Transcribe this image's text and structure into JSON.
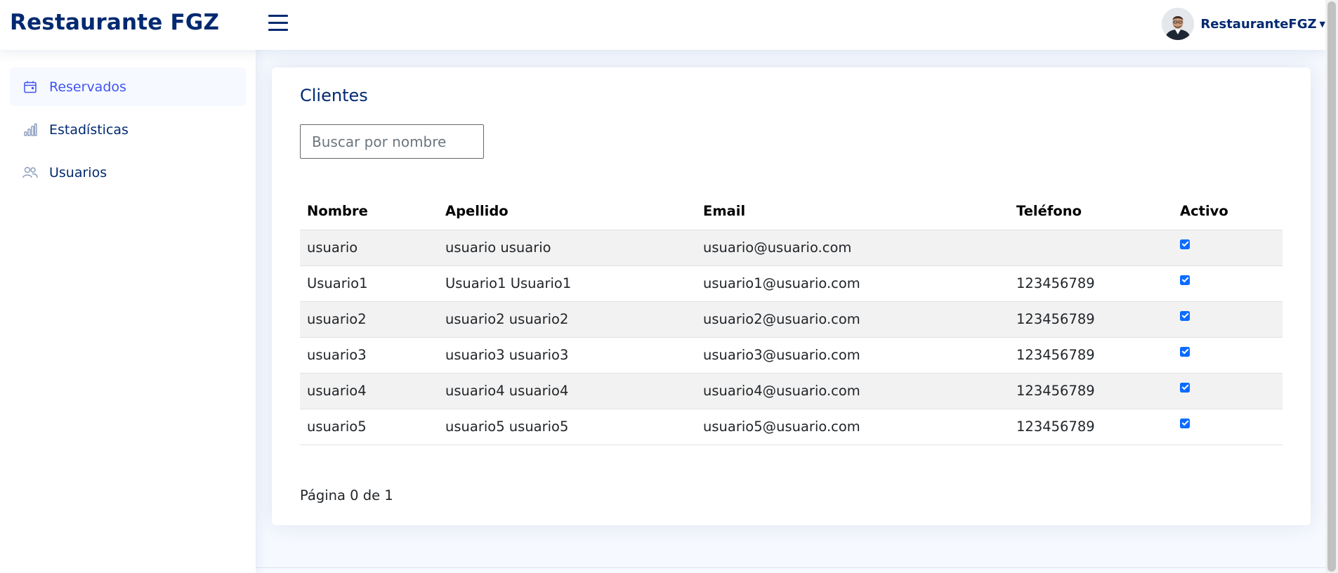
{
  "header": {
    "logo": "Restaurante FGZ",
    "profile_name": "RestauranteFGZ"
  },
  "sidebar": {
    "items": [
      {
        "label": "Reservados",
        "icon": "calendar-icon",
        "active": true
      },
      {
        "label": "Estadísticas",
        "icon": "bar-chart-icon",
        "active": false
      },
      {
        "label": "Usuarios",
        "icon": "people-icon",
        "active": false
      }
    ]
  },
  "main": {
    "title": "Clientes",
    "search_placeholder": "Buscar por nombre",
    "table": {
      "headers": [
        "Nombre",
        "Apellido",
        "Email",
        "Teléfono",
        "Activo"
      ],
      "rows": [
        {
          "nombre": "usuario",
          "apellido": "usuario usuario",
          "email": "usuario@usuario.com",
          "telefono": "",
          "activo": true
        },
        {
          "nombre": "Usuario1",
          "apellido": "Usuario1 Usuario1",
          "email": "usuario1@usuario.com",
          "telefono": "123456789",
          "activo": true
        },
        {
          "nombre": "usuario2",
          "apellido": "usuario2 usuario2",
          "email": "usuario2@usuario.com",
          "telefono": "123456789",
          "activo": true
        },
        {
          "nombre": "usuario3",
          "apellido": "usuario3 usuario3",
          "email": "usuario3@usuario.com",
          "telefono": "123456789",
          "activo": true
        },
        {
          "nombre": "usuario4",
          "apellido": "usuario4 usuario4",
          "email": "usuario4@usuario.com",
          "telefono": "123456789",
          "activo": true
        },
        {
          "nombre": "usuario5",
          "apellido": "usuario5 usuario5",
          "email": "usuario5@usuario.com",
          "telefono": "123456789",
          "activo": true
        }
      ]
    },
    "pagination": "Página 0 de 1"
  },
  "colors": {
    "brand": "#012970",
    "accent": "#4154f1",
    "checkbox": "#0b6cff"
  }
}
